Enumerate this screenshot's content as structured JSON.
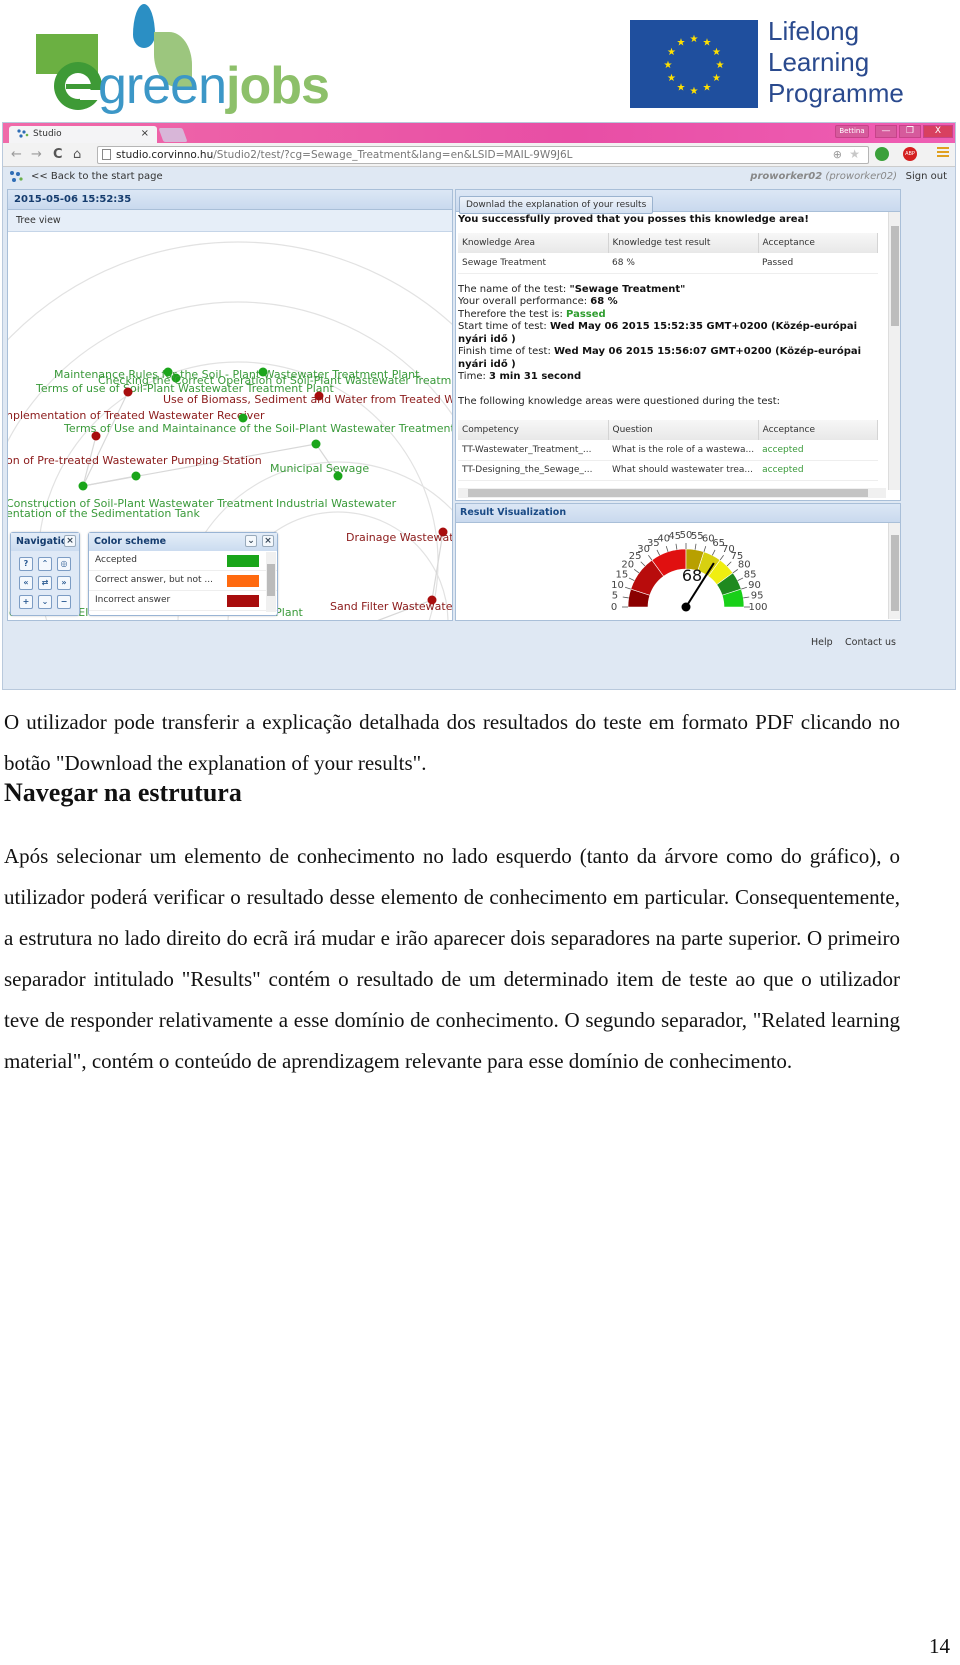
{
  "header": {
    "left_logo": {
      "prefix": "green",
      "suffix": "jobs",
      "initial": "e"
    },
    "right_logo": {
      "lines": [
        "Lifelong",
        "Learning",
        "Programme"
      ]
    }
  },
  "browser": {
    "tab_title": "Studio",
    "tab_close": "×",
    "profile_name": "Bettina",
    "window_controls": {
      "minimize": "—",
      "maximize": "❐",
      "close": "X"
    },
    "url": {
      "host": "studio.corvinno.hu",
      "path": "/Studio2/test/?cg=Sewage_Treatment&lang=en&LSID=MAIL-9W9J6L"
    },
    "nav": {
      "back": "←",
      "forward": "→",
      "reload": "C",
      "home": "⌂"
    },
    "extension_badge": "ABP",
    "app": {
      "back_link": "<< Back to the start page",
      "user_bold": "proworker02",
      "user_paren": "(proworker02)",
      "sign_out": "Sign out"
    },
    "left_pane": {
      "timestamp": "2015-05-06 15:52:35",
      "view_label": "Tree view",
      "graph_nodes": [
        {
          "label": "Maintenance Rules for the Soil - Plant Wastewater Treatment Plant",
          "status": "accepted"
        },
        {
          "label": "Checking the Correct Operation of Soil-Plant Wastewater Treatment Plant",
          "status": "accepted"
        },
        {
          "label": "Terms of use of Soil-Plant Wastewater Treatment Plant",
          "status": "accepted"
        },
        {
          "label": "Use of Biomass, Sediment and Water from Treated Wastew",
          "status": "incorrect"
        },
        {
          "label": "nplementation of Treated Wastewater Receiver",
          "status": "incorrect"
        },
        {
          "label": "Terms of Use and Maintainance of the Soil-Plant Wastewater Treatment",
          "status": "accepted"
        },
        {
          "label": "on of Pre-treated Wastewater Pumping Station",
          "status": "incorrect"
        },
        {
          "label": "Municipal Sewage",
          "status": "accepted"
        },
        {
          "label": "Construction of Soil-Plant Wastewater Treatment",
          "status": "accepted"
        },
        {
          "label": "entation of the Sedimentation Tank",
          "status": "accepted"
        },
        {
          "label": "Industrial Wastewater",
          "status": "accepted"
        },
        {
          "label": "Drainage Wastewater",
          "status": "incorrect"
        },
        {
          "label": "Sand Filter Wastewater T",
          "status": "incorrect"
        },
        {
          "label": "ion of all the Elements of Wastewater Treatment Plant",
          "status": "accepted"
        }
      ],
      "navigation_panel": {
        "title": "Navigatio",
        "buttons": [
          "?",
          "⌃",
          "◎",
          "«",
          "⇄",
          "»",
          "+",
          "⌄",
          "−"
        ]
      },
      "color_scheme_panel": {
        "title": "Color scheme",
        "items": [
          {
            "label": "Accepted",
            "color": "#1aa51a"
          },
          {
            "label": "Correct answer, but not ...",
            "color": "#ff6a10"
          },
          {
            "label": "Incorrect answer",
            "color": "#a80d0d"
          }
        ]
      }
    },
    "right_pane": {
      "download_button": "Downlad the explanation of your results",
      "success_message": "You successfully proved that you posses this knowledge area!",
      "summary_table": {
        "headers": [
          "Knowledge Area",
          "Knowledge test result",
          "Acceptance"
        ],
        "rows": [
          [
            "Sewage Treatment",
            "68 %",
            "Passed"
          ]
        ]
      },
      "details": {
        "name_label": "The name of the test: ",
        "name_value": "\"Sewage Treatment\"",
        "perf_label": "Your overall performance: ",
        "perf_value": "68 %",
        "result_label": "Therefore the test is: ",
        "result_value": "Passed",
        "start_label": "Start time of test: ",
        "start_value": "Wed May 06 2015 15:52:35 GMT+0200 (Közép-európai nyári idő )",
        "finish_label": "Finish time of test: ",
        "finish_value": "Wed May 06 2015 15:56:07 GMT+0200 (Közép-európai nyári idő )",
        "time_label": "Time: ",
        "time_value": "3 min 31 second",
        "areas_intro": "The following knowledge areas were questioned during the test:"
      },
      "competency_table": {
        "headers": [
          "Competency",
          "Question",
          "Acceptance"
        ],
        "rows": [
          [
            "TT-Wastewater_Treatment_...",
            "What is the role of a wastewa...",
            "accepted"
          ],
          [
            "TT-Designing_the_Sewage_...",
            "What should wastewater trea...",
            "accepted"
          ]
        ]
      },
      "visualization_title": "Result Visualization",
      "gauge": {
        "value": 68,
        "min": 0,
        "max": 100,
        "ticks": [
          "0",
          "5",
          "10",
          "15",
          "20",
          "25",
          "30",
          "35",
          "40",
          "45",
          "50",
          "55",
          "60",
          "65",
          "70",
          "75",
          "80",
          "85",
          "90",
          "95",
          "100"
        ],
        "bands": [
          {
            "from": 0,
            "to": 10,
            "color": "#8b0000"
          },
          {
            "from": 10,
            "to": 30,
            "color": "#b80c0c"
          },
          {
            "from": 30,
            "to": 50,
            "color": "#e01010"
          },
          {
            "from": 50,
            "to": 60,
            "color": "#b8a000"
          },
          {
            "from": 60,
            "to": 70,
            "color": "#d8d010"
          },
          {
            "from": 70,
            "to": 80,
            "color": "#f0ee10"
          },
          {
            "from": 80,
            "to": 90,
            "color": "#1f8a1f"
          },
          {
            "from": 90,
            "to": 100,
            "color": "#18d018"
          }
        ]
      }
    },
    "footer": {
      "help": "Help",
      "contact": "Contact us"
    }
  },
  "document": {
    "para1": "O utilizador pode transferir a explicação detalhada dos resultados do teste em formato PDF clicando no botão \"Download the explanation of your results\".",
    "heading": "Navegar na estrutura",
    "para2": "Após selecionar um elemento de conhecimento no lado esquerdo (tanto da árvore como do gráfico), o utilizador poderá verificar o resultado desse elemento de conhecimento em particular. Consequentemente, a estrutura no lado direito do ecrã irá mudar e irão aparecer dois separadores na parte superior. O primeiro separador intitulado \"Results\" contém o resultado de um determinado item de teste ao que o utilizador teve de responder relativamente a esse domínio de conhecimento. O segundo separador, \"Related learning material\", contém o conteúdo de aprendizagem relevante para esse domínio de conhecimento.",
    "page_number": "14"
  },
  "colors": {
    "accepted": "#1aa51a",
    "incorrect": "#a80d0d",
    "partial": "#ff6a10",
    "accepted_text": "#3a9a3a",
    "incorrect_text": "#8b1a1a"
  }
}
